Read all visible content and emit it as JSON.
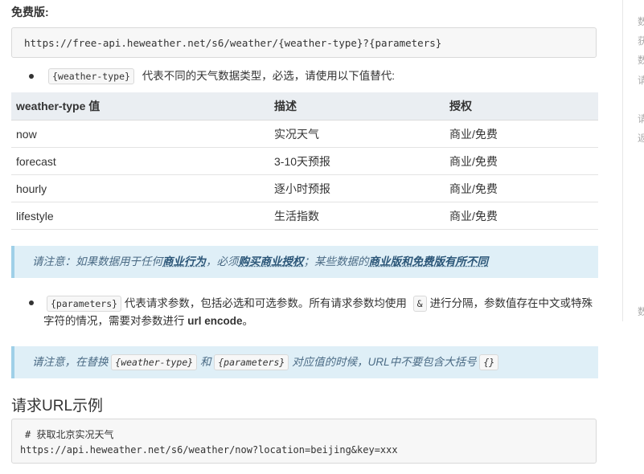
{
  "free_title": "免费版:",
  "free_url": "https://free-api.heweather.net/s6/weather/{weather-type}?{parameters}",
  "bullet1": {
    "code": "{weather-type}",
    "text": "代表不同的天气数据类型，必选，请使用以下值替代:"
  },
  "table": {
    "headers": [
      "weather-type 值",
      "描述",
      "授权"
    ],
    "rows": [
      [
        "now",
        "实况天气",
        "商业/免费"
      ],
      [
        "forecast",
        "3-10天预报",
        "商业/免费"
      ],
      [
        "hourly",
        "逐小时预报",
        "商业/免费"
      ],
      [
        "lifestyle",
        "生活指数",
        "商业/免费"
      ]
    ]
  },
  "note1": {
    "p1": "请注意：如果数据用于任何",
    "b1": "商业行为",
    "p2": "，必须",
    "b2": "购买商业授权",
    "p3": "；某些数据的",
    "b3": "商业版和免费版有所不同"
  },
  "bullet2": {
    "code": "{parameters}",
    "t1": "代表请求参数，包括必选和可选参数。所有请求参数均使用",
    "amp": "&",
    "t2": "进行分隔，参数值存在中文或特殊字符的情况，需要对参数进行",
    "bold": "url encode",
    "t3": "。"
  },
  "note2": {
    "p1": "请注意，在替换",
    "code1": "{weather-type}",
    "p2": "和",
    "code2": "{parameters}",
    "p3": "对应值的时候，URL中不要包含大括号",
    "code3": "{}"
  },
  "example_title": "请求URL示例",
  "example": {
    "comment": "# 获取北京实况天气",
    "url": "https://api.heweather.net/s6/weather/now?location=beijing&key=xxx"
  },
  "right_panel_chars": [
    "数",
    "获",
    "数",
    "请",
    "请",
    "返",
    "数"
  ]
}
